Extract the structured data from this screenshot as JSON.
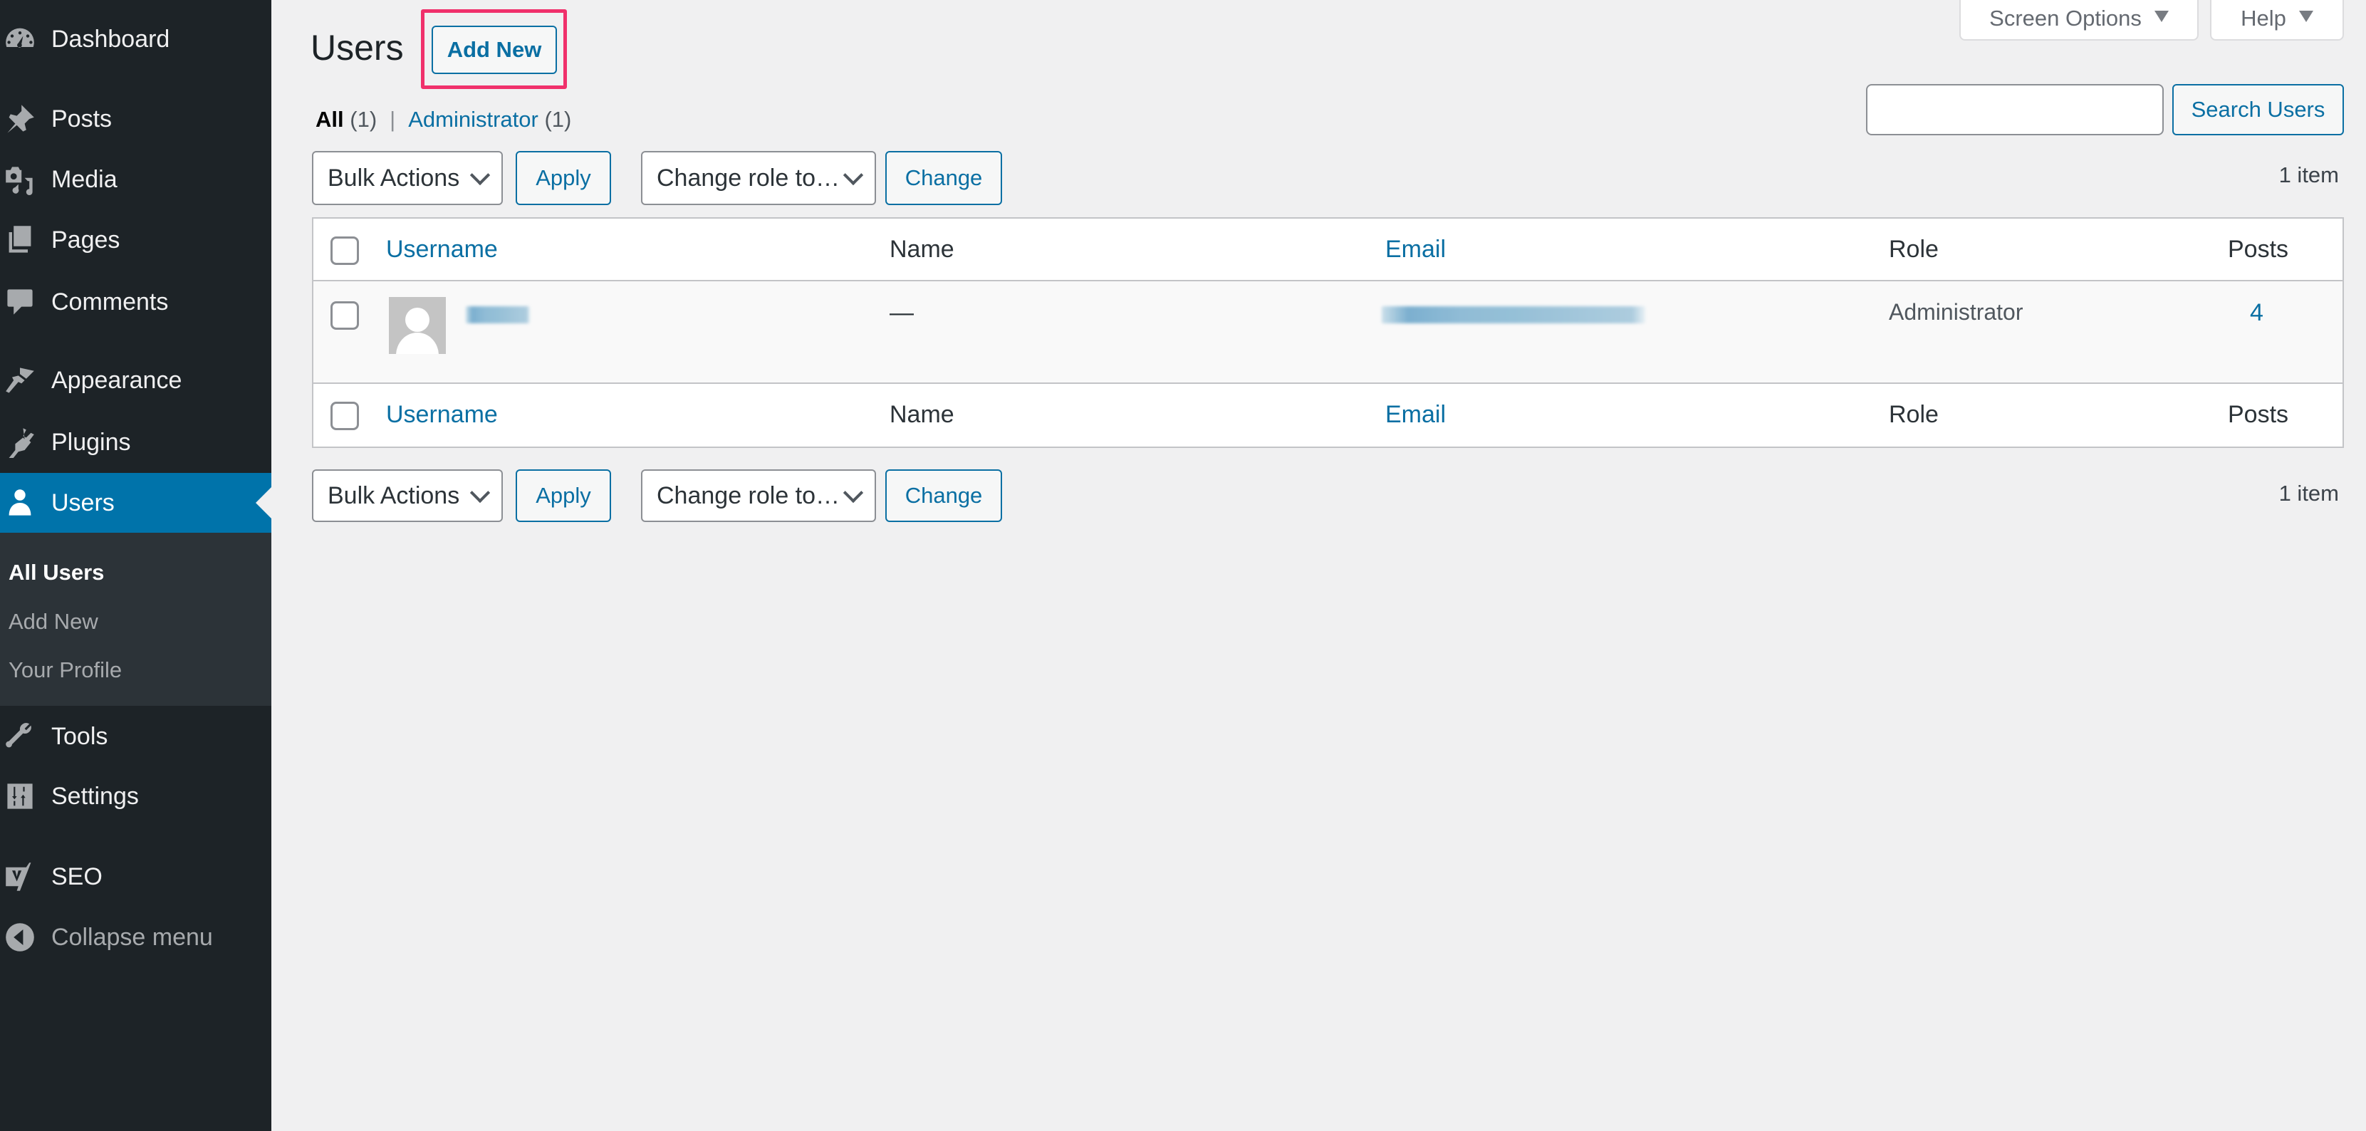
{
  "sidebar": {
    "items": [
      {
        "label": "Dashboard",
        "icon": "dashboard-icon"
      },
      {
        "label": "Posts",
        "icon": "pushpin-icon"
      },
      {
        "label": "Media",
        "icon": "media-icon"
      },
      {
        "label": "Pages",
        "icon": "pages-icon"
      },
      {
        "label": "Comments",
        "icon": "comment-icon"
      },
      {
        "label": "Appearance",
        "icon": "paintbrush-icon"
      },
      {
        "label": "Plugins",
        "icon": "plugin-icon"
      },
      {
        "label": "Users",
        "icon": "user-icon",
        "active": true
      },
      {
        "label": "Tools",
        "icon": "wrench-icon"
      },
      {
        "label": "Settings",
        "icon": "settings-icon"
      },
      {
        "label": "SEO",
        "icon": "yoast-icon"
      }
    ],
    "submenu": [
      {
        "label": "All Users",
        "current": true
      },
      {
        "label": "Add New"
      },
      {
        "label": "Your Profile"
      }
    ],
    "collapse_label": "Collapse menu"
  },
  "header": {
    "title": "Users",
    "add_new_label": "Add New",
    "screen_options_label": "Screen Options",
    "help_label": "Help"
  },
  "filters": {
    "all_label": "All",
    "all_count": "(1)",
    "separator": "|",
    "admin_label": "Administrator",
    "admin_count": "(1)"
  },
  "search": {
    "value": "",
    "placeholder": "",
    "button_label": "Search Users"
  },
  "toolbar": {
    "bulk_actions_label": "Bulk Actions",
    "apply_label": "Apply",
    "change_role_label": "Change role to…",
    "change_label": "Change",
    "item_count": "1 item"
  },
  "table": {
    "columns": [
      "Username",
      "Name",
      "Email",
      "Role",
      "Posts"
    ],
    "rows": [
      {
        "username": "[redacted]",
        "name": "—",
        "email": "[redacted]",
        "role": "Administrator",
        "posts": "4"
      }
    ]
  },
  "colors": {
    "sidebar_bg": "#1d2327",
    "active_menu": "#0073aa",
    "link": "#0a6fa3",
    "highlight_box": "#f0306b"
  }
}
